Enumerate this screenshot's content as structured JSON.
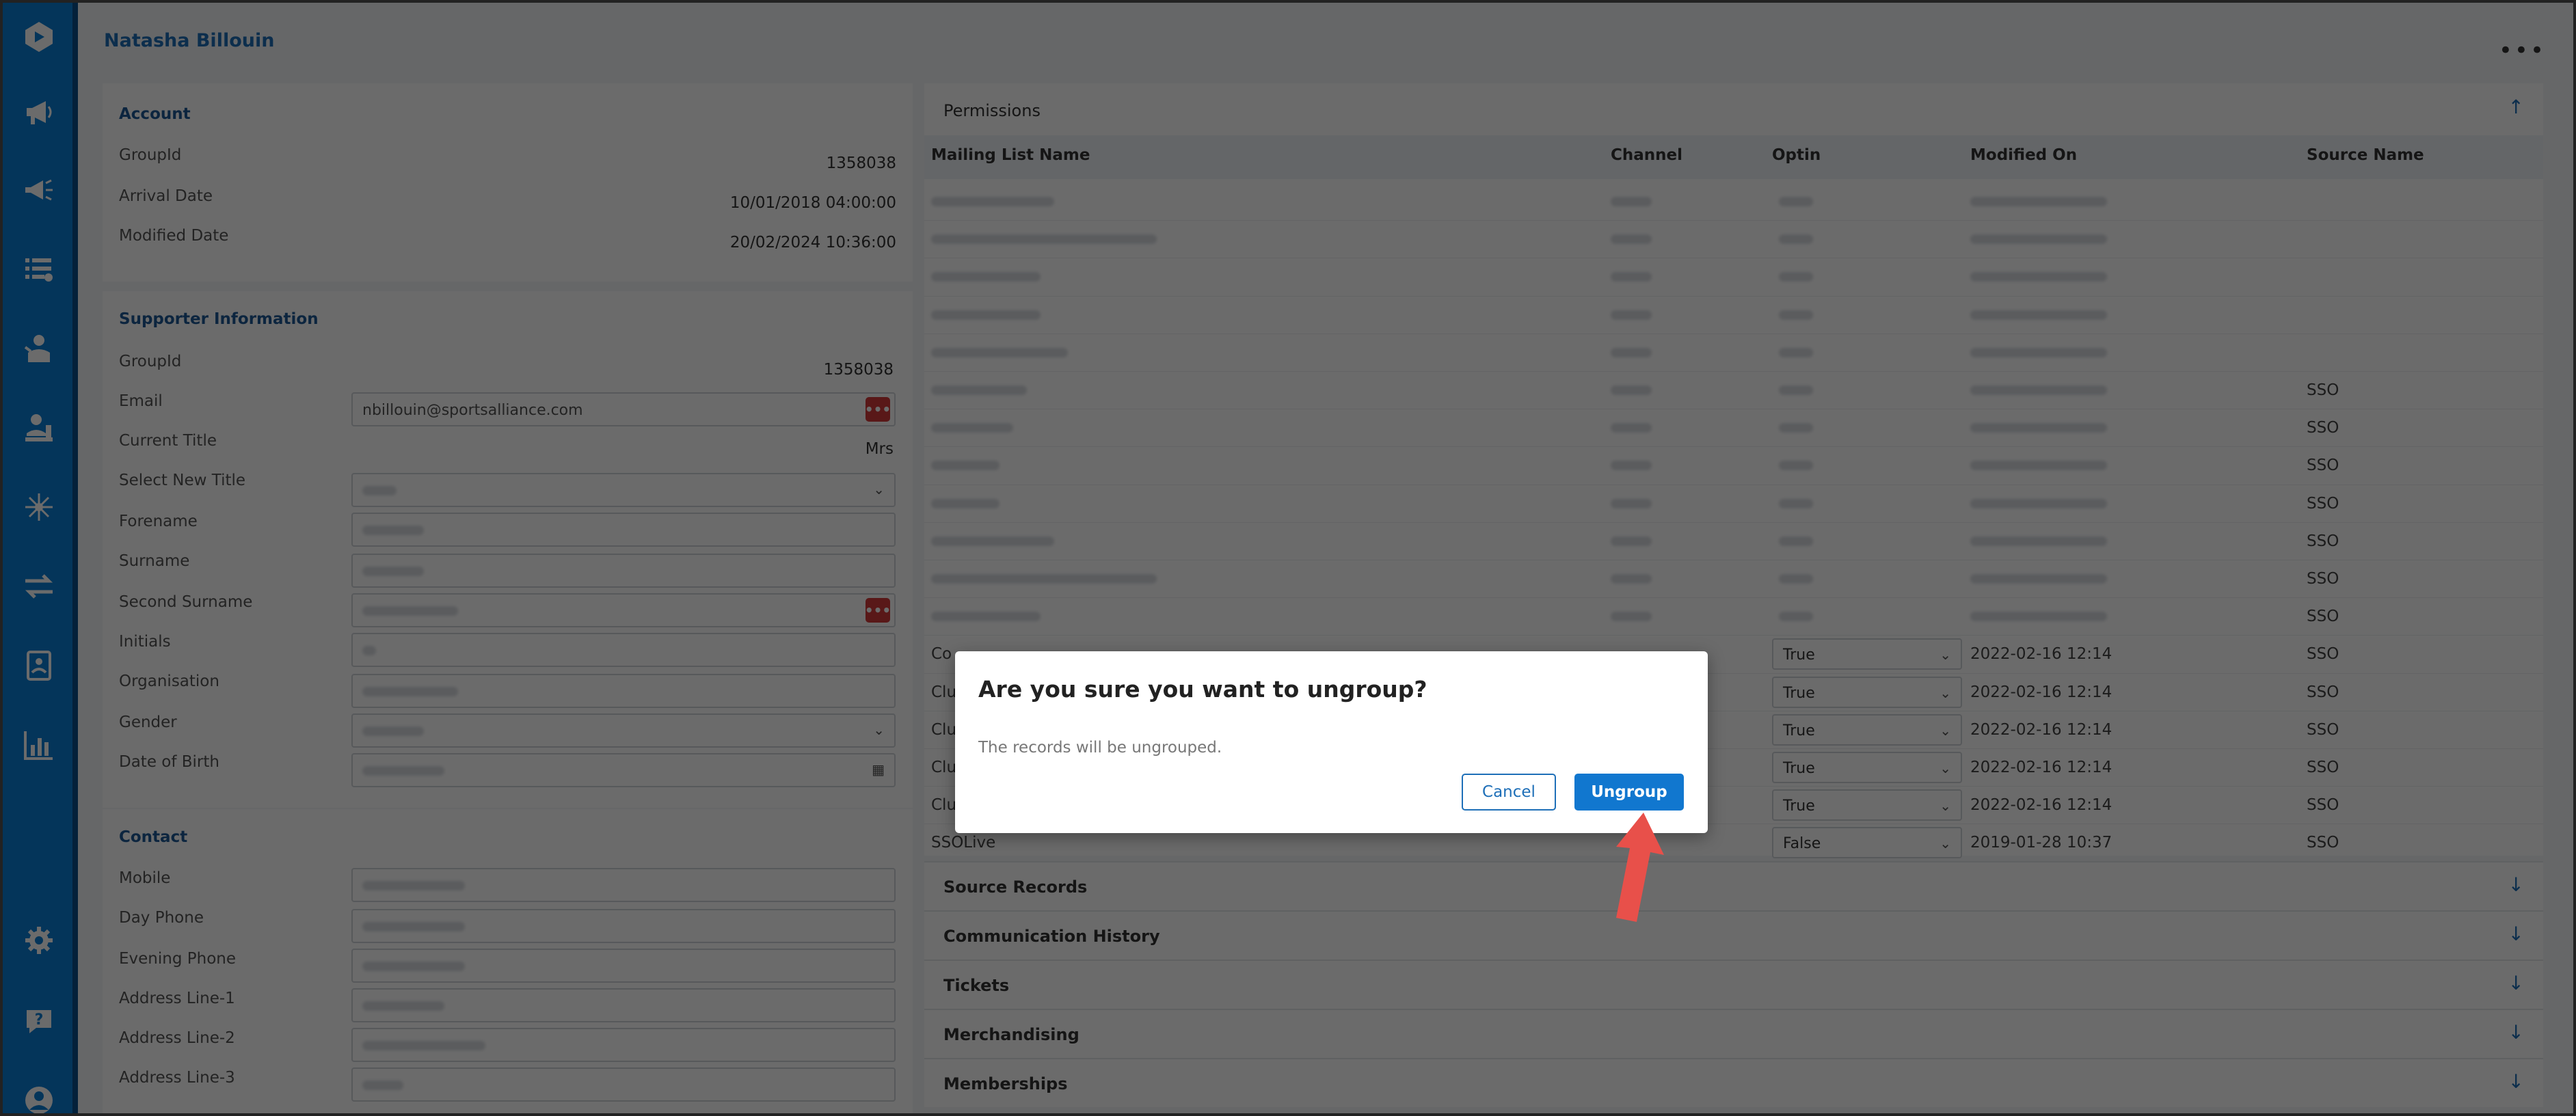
{
  "header": {
    "person_name": "Natasha Billouin"
  },
  "sidebar": {
    "icons": [
      "logo-icon",
      "megaphone-icon",
      "campaign-icon",
      "lists-icon",
      "supporter-icon",
      "person-desk-icon",
      "network-icon",
      "transfer-icon",
      "contacts-icon",
      "reports-icon",
      "settings-icon",
      "help-icon",
      "user-icon"
    ]
  },
  "account": {
    "title": "Account",
    "fields": [
      {
        "label": "GroupId",
        "value": "1358038"
      },
      {
        "label": "Arrival Date",
        "value": "10/01/2018 04:00:00"
      },
      {
        "label": "Modified Date",
        "value": "20/02/2024 10:36:00"
      }
    ]
  },
  "supporter": {
    "title": "Supporter Information",
    "groupid_label": "GroupId",
    "groupid_value": "1358038",
    "email_label": "Email",
    "email_value": "nbillouin@sportsalliance.com",
    "current_title_label": "Current Title",
    "current_title_value": "Mrs",
    "labels": [
      "Select New Title",
      "Forename",
      "Surname",
      "Second Surname",
      "Initials",
      "Organisation",
      "Gender",
      "Date of Birth"
    ]
  },
  "contact": {
    "title": "Contact",
    "labels": [
      "Mobile",
      "Day Phone",
      "Evening Phone",
      "Address Line-1",
      "Address Line-2",
      "Address Line-3"
    ]
  },
  "permissions": {
    "title": "Permissions",
    "columns": [
      "Mailing List Name",
      "Channel",
      "Optin",
      "Modified On",
      "Source Name"
    ],
    "source_names": [
      "",
      "",
      "",
      "",
      "",
      "SSO",
      "SSO",
      "SSO",
      "SSO",
      "SSO",
      "SSO",
      "SSO",
      "SSO",
      "SSO",
      "SSO",
      "SSO",
      "SSO",
      "SSO"
    ],
    "visible_rows": [
      {
        "name_prefix": "Co",
        "optin": "True",
        "modified": "2022-02-16 12:14",
        "source": "SSO"
      },
      {
        "name_prefix": "Clu",
        "optin": "True",
        "modified": "2022-02-16 12:14",
        "source": "SSO"
      },
      {
        "name_prefix": "Clu",
        "optin": "True",
        "modified": "2022-02-16 12:14",
        "source": "SSO"
      },
      {
        "name_prefix": "Clu",
        "optin": "True",
        "modified": "2022-02-16 12:14",
        "source": "SSO"
      },
      {
        "name_prefix": "Clu",
        "optin": "True",
        "modified": "2022-02-16 12:14",
        "source": "SSO"
      },
      {
        "name_prefix": "SSOLive",
        "optin": "False",
        "modified": "2019-01-28 10:37",
        "source": "SSO"
      }
    ]
  },
  "sections": [
    "Source Records",
    "Communication History",
    "Tickets",
    "Merchandising",
    "Memberships"
  ],
  "dialog": {
    "title": "Are you sure you want to ungroup?",
    "message": "The records will be ungrouped.",
    "cancel_label": "Cancel",
    "confirm_label": "Ungroup"
  },
  "colors": {
    "sidebar": "#0a7ed6",
    "primary_button": "#1177cf",
    "pointer_arrow": "#e8504a"
  }
}
